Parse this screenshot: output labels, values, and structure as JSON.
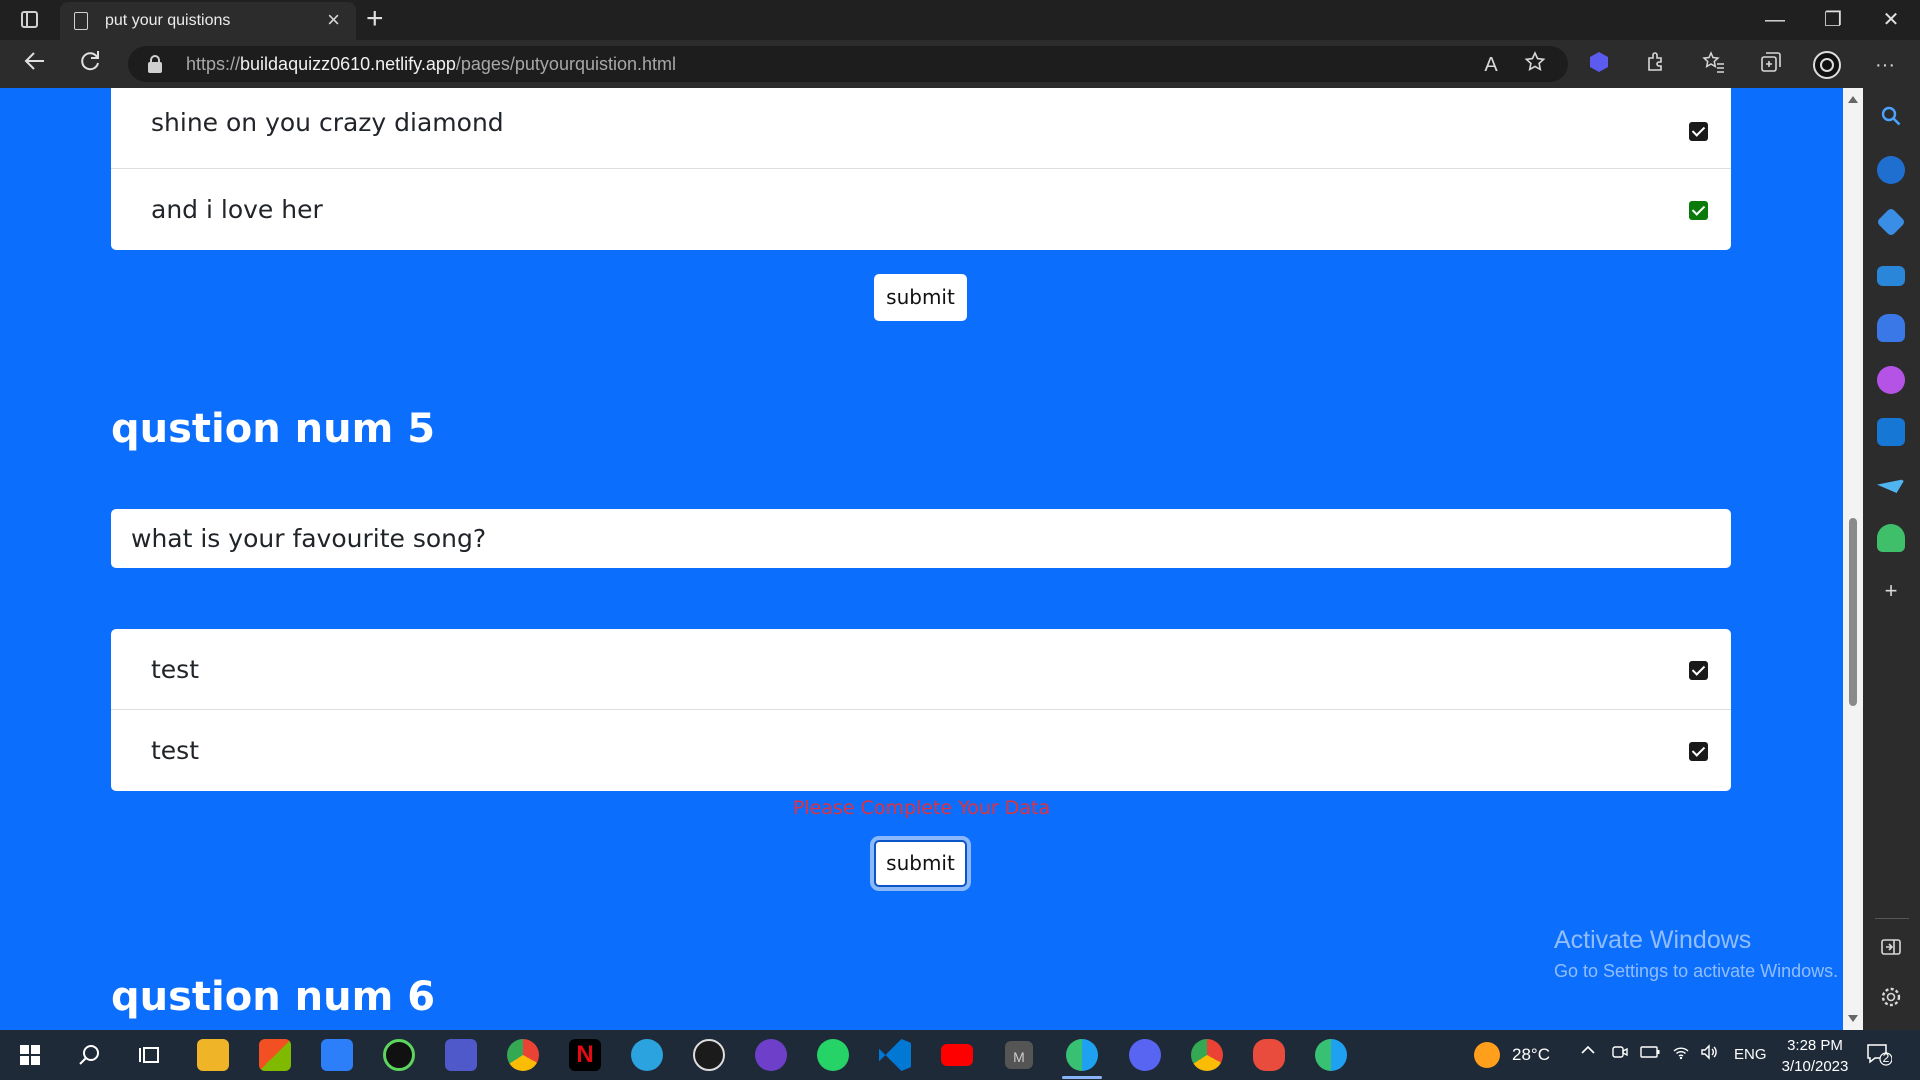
{
  "browser": {
    "tab_title": "put your quistions",
    "tab_close": "×",
    "new_tab": "+",
    "url_scheme": "https://",
    "url_host": "buildaquizz0610.netlify.app",
    "url_path": "/pages/putyourquistion.html",
    "read_aloud": "A",
    "window_minimize": "—",
    "window_restore": "❐",
    "window_close": "✕",
    "more_menu": "···"
  },
  "page": {
    "prev_options": [
      {
        "text": "shine on you crazy diamond",
        "checked": true,
        "check_color": "#1a1a1a"
      },
      {
        "text": "and i love her",
        "checked": true,
        "check_color": "#0a7a0a"
      }
    ],
    "submit_label_1": "submit",
    "question5_heading": "qustion num 5",
    "question5_text": "what is your favourite song?",
    "q5_options": [
      {
        "text": "test",
        "checked": true
      },
      {
        "text": "test",
        "checked": true
      }
    ],
    "error_message": "Please Complete Your Data",
    "submit_label_2": "submit",
    "question6_heading": "qustion num 6"
  },
  "watermark": {
    "title": "Activate Windows",
    "subtitle": "Go to Settings to activate Windows."
  },
  "taskbar": {
    "weather_temp": "28°C",
    "language": "ENG",
    "time": "3:28 PM",
    "date": "3/10/2023",
    "notification_count": "2"
  },
  "colors": {
    "page_background": "#0b6efd",
    "error": "#e0323e",
    "chrome_dark": "#202020"
  }
}
